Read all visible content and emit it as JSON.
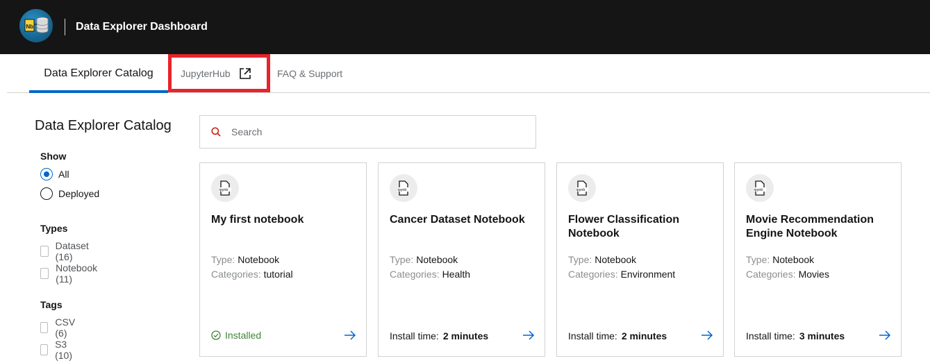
{
  "header": {
    "title": "Data Explorer Dashboard",
    "logo_text": "Nb"
  },
  "tabs": [
    {
      "label": "Data Explorer Catalog",
      "active": true
    },
    {
      "label": "JupyterHub",
      "external": true
    },
    {
      "label": "FAQ & Support"
    }
  ],
  "sidebar": {
    "title": "Data Explorer Catalog",
    "show": {
      "heading": "Show",
      "options": [
        {
          "label": "All",
          "selected": true
        },
        {
          "label": "Deployed",
          "selected": false
        }
      ]
    },
    "types": {
      "heading": "Types",
      "options": [
        {
          "label": "Dataset (16)"
        },
        {
          "label": "Notebook (11)"
        }
      ]
    },
    "tags": {
      "heading": "Tags",
      "options": [
        {
          "label": "CSV (6)"
        },
        {
          "label": "S3 (10)"
        }
      ]
    }
  },
  "search": {
    "placeholder": "Search"
  },
  "cards": [
    {
      "icon_text": "ipynb",
      "title": "My first notebook",
      "type_key": "Type:",
      "type_value": "Notebook",
      "cat_key": "Categories:",
      "cat_value": "tutorial",
      "status": "Installed"
    },
    {
      "icon_text": "ipynb",
      "title": "Cancer Dataset Notebook",
      "type_key": "Type:",
      "type_value": "Notebook",
      "cat_key": "Categories:",
      "cat_value": "Health",
      "install_key": "Install time:",
      "install_value": "2 minutes"
    },
    {
      "icon_text": "ipynb",
      "title": "Flower Classification Notebook",
      "type_key": "Type:",
      "type_value": "Notebook",
      "cat_key": "Categories:",
      "cat_value": "Environment",
      "install_key": "Install time:",
      "install_value": "2 minutes"
    },
    {
      "icon_text": "ipynb",
      "title": "Movie Recommendation Engine Notebook",
      "type_key": "Type:",
      "type_value": "Notebook",
      "cat_key": "Categories:",
      "cat_value": "Movies",
      "install_key": "Install time:",
      "install_value": "3 minutes"
    }
  ],
  "colors": {
    "topbar": "#151515",
    "accent": "#0066cc",
    "highlight": "#e8232b",
    "installed": "#3e8635"
  }
}
